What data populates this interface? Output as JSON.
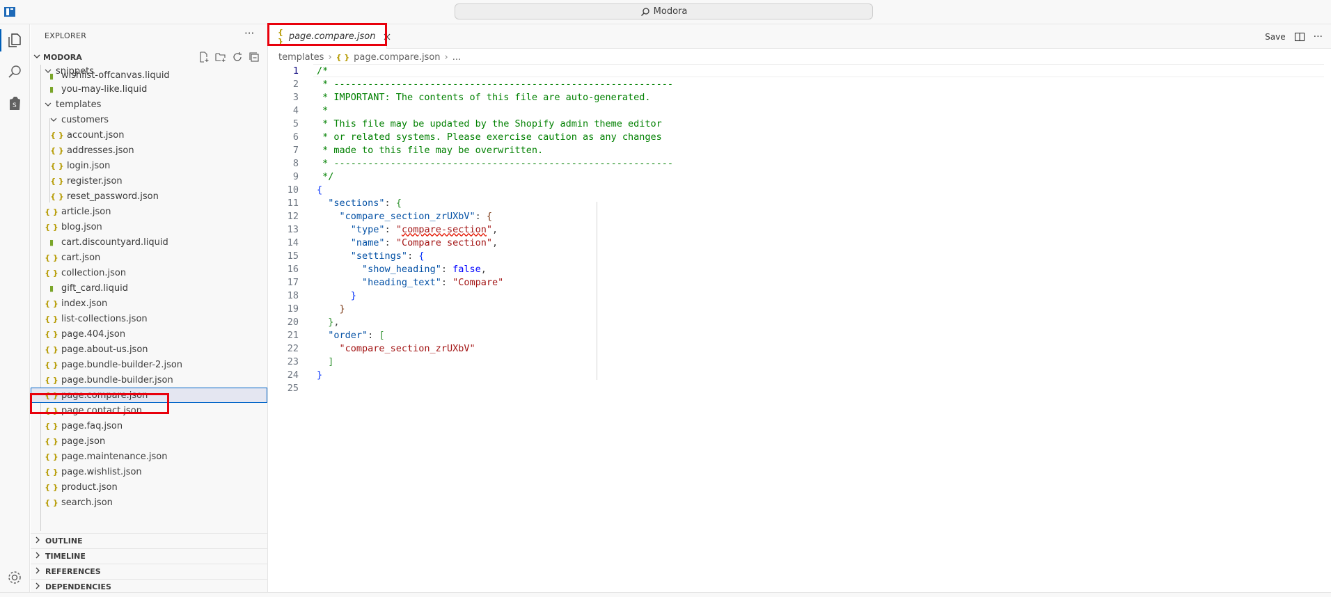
{
  "window": {
    "title": "Modora"
  },
  "activity": {
    "icons": [
      "files-icon",
      "search-icon",
      "shopify-icon",
      "settings-gear-icon"
    ]
  },
  "sidebar": {
    "header": "EXPLORER",
    "more": "···",
    "project": "MODORA",
    "tree": [
      {
        "label": "snippets",
        "type": "folder",
        "level": 1
      },
      {
        "label": "wishlist-offcanvas.liquid",
        "type": "liquid",
        "level": 2
      },
      {
        "label": "you-may-like.liquid",
        "type": "liquid",
        "level": 2
      },
      {
        "label": "templates",
        "type": "folder",
        "level": 1
      },
      {
        "label": "customers",
        "type": "folder",
        "level": 2
      },
      {
        "label": "account.json",
        "type": "json",
        "level": 3
      },
      {
        "label": "addresses.json",
        "type": "json",
        "level": 3
      },
      {
        "label": "login.json",
        "type": "json",
        "level": 3
      },
      {
        "label": "register.json",
        "type": "json",
        "level": 3
      },
      {
        "label": "reset_password.json",
        "type": "json",
        "level": 3
      },
      {
        "label": "article.json",
        "type": "json",
        "level": 2
      },
      {
        "label": "blog.json",
        "type": "json",
        "level": 2
      },
      {
        "label": "cart.discountyard.liquid",
        "type": "liquid",
        "level": 2
      },
      {
        "label": "cart.json",
        "type": "json",
        "level": 2
      },
      {
        "label": "collection.json",
        "type": "json",
        "level": 2
      },
      {
        "label": "gift_card.liquid",
        "type": "liquid",
        "level": 2
      },
      {
        "label": "index.json",
        "type": "json",
        "level": 2
      },
      {
        "label": "list-collections.json",
        "type": "json",
        "level": 2
      },
      {
        "label": "page.404.json",
        "type": "json",
        "level": 2
      },
      {
        "label": "page.about-us.json",
        "type": "json",
        "level": 2
      },
      {
        "label": "page.bundle-builder-2.json",
        "type": "json",
        "level": 2
      },
      {
        "label": "page.bundle-builder.json",
        "type": "json",
        "level": 2
      },
      {
        "label": "page.compare.json",
        "type": "json",
        "level": 2,
        "selected": true
      },
      {
        "label": "page.contact.json",
        "type": "json",
        "level": 2
      },
      {
        "label": "page.faq.json",
        "type": "json",
        "level": 2
      },
      {
        "label": "page.json",
        "type": "json",
        "level": 2
      },
      {
        "label": "page.maintenance.json",
        "type": "json",
        "level": 2
      },
      {
        "label": "page.wishlist.json",
        "type": "json",
        "level": 2
      },
      {
        "label": "product.json",
        "type": "json",
        "level": 2
      },
      {
        "label": "search.json",
        "type": "json",
        "level": 2
      }
    ],
    "sections": [
      "OUTLINE",
      "TIMELINE",
      "REFERENCES",
      "DEPENDENCIES"
    ]
  },
  "editor": {
    "tab": {
      "label": "page.compare.json",
      "close": "×"
    },
    "save_label": "Save",
    "more": "···",
    "breadcrumbs": [
      "templates",
      "page.compare.json",
      "..."
    ],
    "lines": [
      "1",
      "2",
      "3",
      "4",
      "5",
      "6",
      "7",
      "8",
      "9",
      "10",
      "11",
      "12",
      "13",
      "14",
      "15",
      "16",
      "17",
      "18",
      "19",
      "20",
      "21",
      "22",
      "23",
      "24",
      "25"
    ],
    "code": {
      "l1": "/*",
      "l2": " * ------------------------------------------------------------",
      "l3": " * IMPORTANT: The contents of this file are auto-generated.",
      "l4": " *",
      "l5": " * This file may be updated by the Shopify admin theme editor",
      "l6": " * or related systems. Please exercise caution as any changes",
      "l7": " * made to this file may be overwritten.",
      "l8": " * ------------------------------------------------------------",
      "l9": " */",
      "open_brace": "{",
      "sections_key": "\"sections\"",
      "compare_key": "\"compare_section_zrUXbV\"",
      "type_key": "\"type\"",
      "type_val_q": "\"",
      "type_val": "compare-section",
      "name_key": "\"name\"",
      "name_val": "\"Compare section\"",
      "settings_key": "\"settings\"",
      "show_heading_key": "\"show_heading\"",
      "show_heading_val": "false",
      "heading_text_key": "\"heading_text\"",
      "heading_text_val": "\"Compare\"",
      "order_key": "\"order\"",
      "order_val": "\"compare_section_zrUXbV\"",
      "close_brace": "}"
    }
  }
}
